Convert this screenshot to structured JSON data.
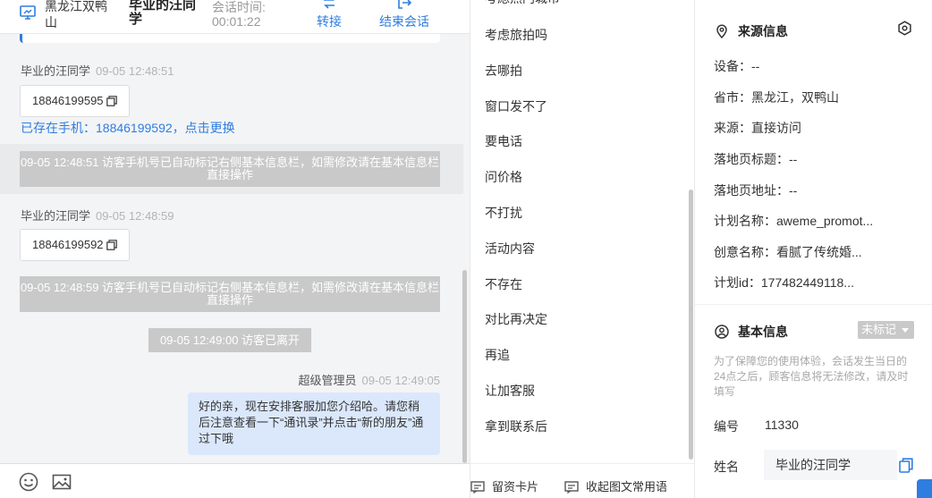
{
  "header": {
    "location": "黑龙江双鸭山",
    "visitor": "毕业的汪同学",
    "session_time_label": "会话时间:",
    "session_time": "00:01:22",
    "transfer_label": "转接",
    "end_label": "结束会话"
  },
  "messages": [
    {
      "sender": "毕业的汪同学",
      "time": "09-05 12:48:51",
      "phone": "18846199595"
    },
    {
      "link": "已存在手机：18846199592，点击更换"
    },
    {
      "system": "09-05 12:48:51 访客手机号已自动标记右侧基本信息栏，如需修改请在基本信息栏直接操作"
    },
    {
      "sender": "毕业的汪同学",
      "time": "09-05 12:48:59",
      "phone": "18846199592"
    },
    {
      "system": "09-05 12:48:59 访客手机号已自动标记右侧基本信息栏，如需修改请在基本信息栏直接操作"
    },
    {
      "leave": "09-05 12:49:00 访客已离开"
    },
    {
      "sender": "超级管理员",
      "time": "09-05 12:49:05",
      "text": "好的亲，现在安排客服加您介绍哈。请您稍后注意查看一下“通讯录”并点击“新的朋友”通过下哦"
    }
  ],
  "quick_replies": {
    "top_partial": "考虑热门城市",
    "items": [
      "考虑旅拍吗",
      "去哪拍",
      "窗口发不了",
      "要电话",
      "问价格",
      "不打扰",
      "活动内容",
      "不存在",
      "对比再决定",
      "再追",
      "让加客服",
      "拿到联系后"
    ],
    "footer": {
      "card": "留资卡片",
      "collapse": "收起图文常用语"
    }
  },
  "source_info": {
    "title": "来源信息",
    "device": "设备：--",
    "province_city": "省市：黑龙江，双鸭山",
    "source": "来源：直接访问",
    "landing_title": "落地页标题：--",
    "landing_url": "落地页地址：--",
    "plan_name": "计划名称：aweme_promot...",
    "creative_name": "创意名称：看腻了传统婚...",
    "plan_id": "计划id：177482449118..."
  },
  "basic_info": {
    "title": "基本信息",
    "tag": "未标记",
    "notice": "为了保障您的使用体验，会话发生当日的24点之后，顾客信息将无法修改，请及时填写",
    "number_label": "编号",
    "number": "11330",
    "name_label": "姓名",
    "name": "毕业的汪同学"
  },
  "colors": {
    "accent": "#2f7de1",
    "system_msg": "#c9c9c9",
    "agent_bubble": "#dbe8fc"
  }
}
